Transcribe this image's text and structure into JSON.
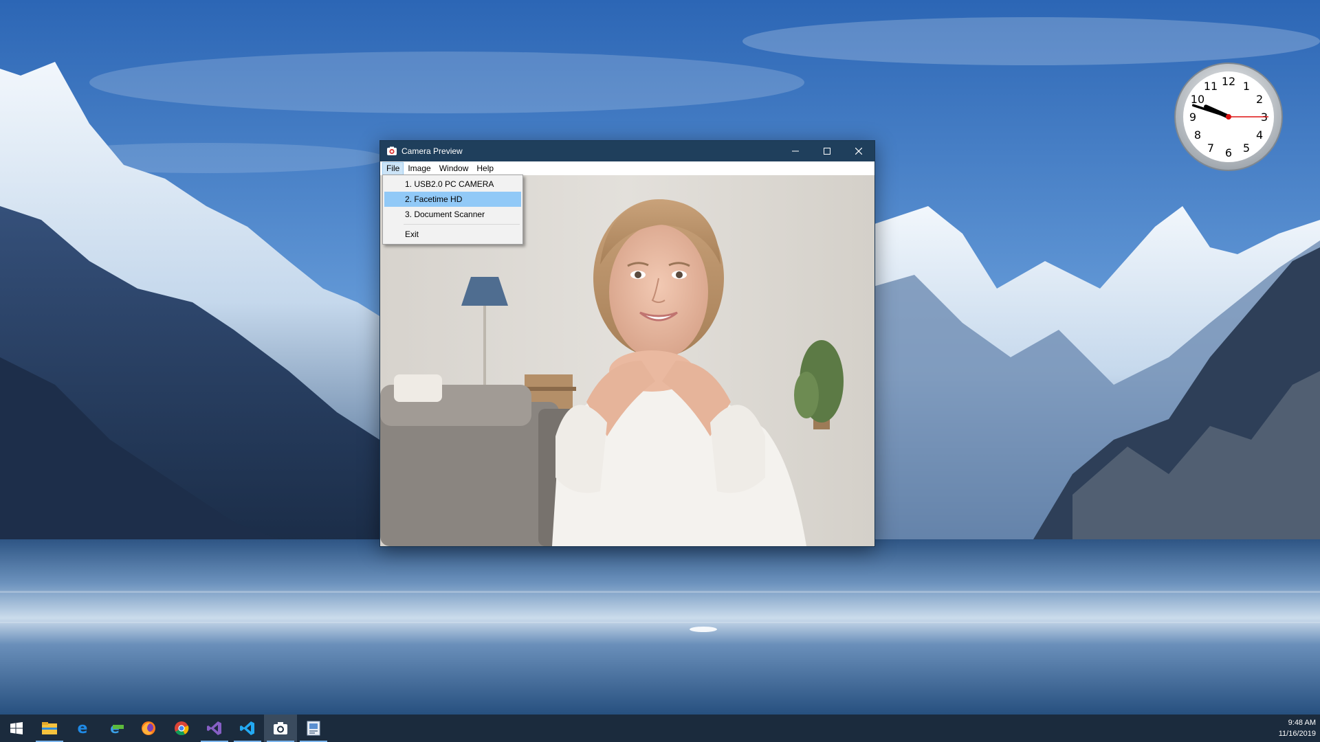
{
  "window": {
    "title": "Camera Preview",
    "menus": [
      "File",
      "Image",
      "Window",
      "Help"
    ],
    "active_menu": "File"
  },
  "file_menu": {
    "items": [
      {
        "label": "1. USB2.0 PC CAMERA",
        "selected": false
      },
      {
        "label": "2. Facetime HD",
        "selected": true
      },
      {
        "label": "3. Document Scanner",
        "selected": false
      }
    ],
    "exit_label": "Exit"
  },
  "clock": {
    "numbers": [
      "12",
      "1",
      "2",
      "3",
      "4",
      "5",
      "6",
      "7",
      "8",
      "9",
      "10",
      "11"
    ],
    "hour": 9,
    "minute": 48,
    "second": 15
  },
  "taskbar": {
    "apps": [
      "start-icon",
      "file-explorer-icon",
      "edge-icon",
      "ie-beta-icon",
      "firefox-icon",
      "chrome-icon",
      "visual-studio-icon",
      "vscode-icon",
      "camera-preview-icon",
      "image-app-icon"
    ],
    "time": "9:48 AM",
    "date": "11/16/2019"
  },
  "colors": {
    "titlebar": "#1f3f5c",
    "menu_highlight": "#91c9f7",
    "taskbar": "#1b2b3d"
  }
}
